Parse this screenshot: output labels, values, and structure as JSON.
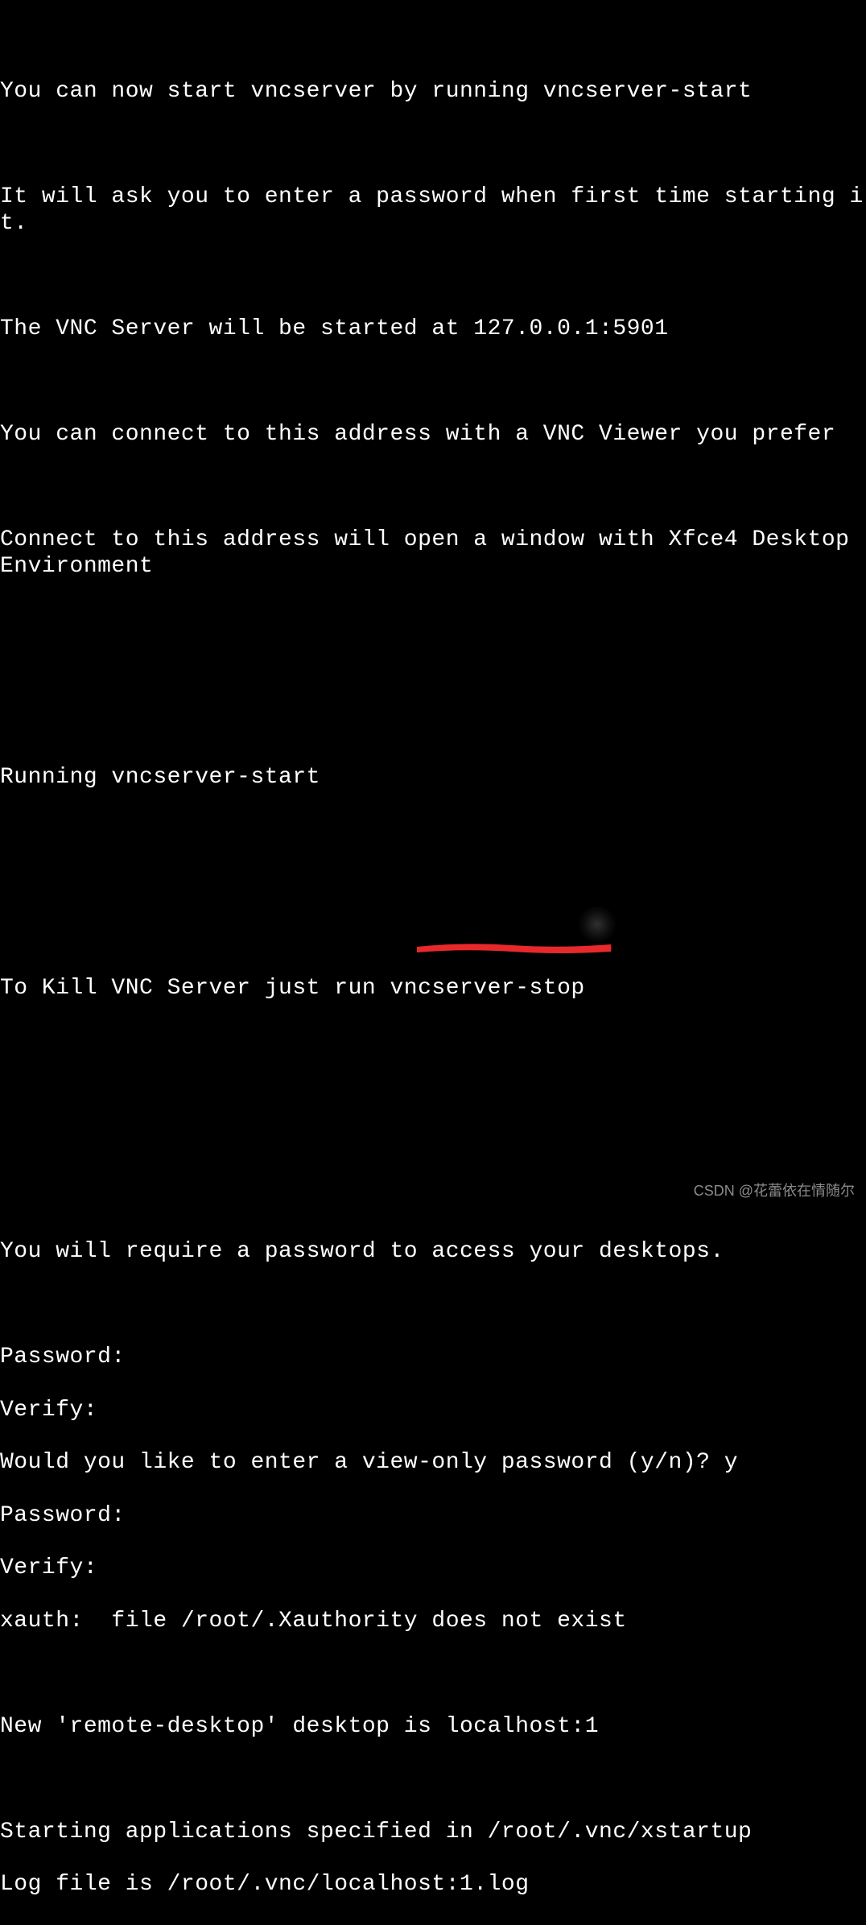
{
  "terminal": {
    "lines": [
      "",
      "You can now start vncserver by running vncserver-start",
      "",
      "It will ask you to enter a password when first time starting it.",
      "",
      "The VNC Server will be started at 127.0.0.1:5901",
      "",
      "You can connect to this address with a VNC Viewer you prefer",
      "",
      "Connect to this address will open a window with Xfce4 Desktop Environment",
      "",
      "",
      "",
      "Running vncserver-start",
      "",
      "",
      "",
      "To Kill VNC Server just run vncserver-stop",
      "",
      "",
      "",
      "",
      "You will require a password to access your desktops.",
      "",
      "Password:",
      "Verify:",
      "Would you like to enter a view-only password (y/n)? y",
      "Password:",
      "Verify:",
      "xauth:  file /root/.Xauthority does not exist",
      "",
      "New 'remote-desktop' desktop is localhost:1",
      "",
      "Starting applications specified in /root/.vnc/xstartup",
      "Log file is /root/.vnc/localhost:1.log"
    ]
  },
  "annotation": {
    "underline_color": "#e8292c"
  },
  "watermark": {
    "text": "CSDN @花蕾依在情随尔"
  }
}
